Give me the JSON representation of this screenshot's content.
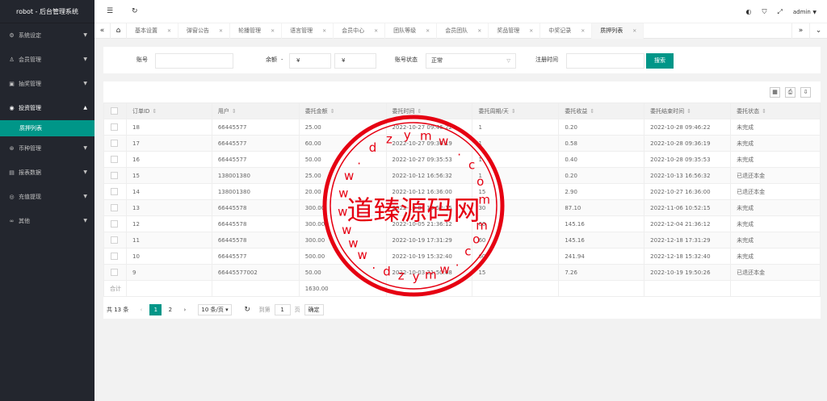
{
  "app_title": "robot - 后台管理系统",
  "sidebar": {
    "items": [
      {
        "icon": "⚙",
        "label": "系统设定"
      },
      {
        "icon": "♙",
        "label": "会员管理"
      },
      {
        "icon": "▣",
        "label": "抽奖管理"
      },
      {
        "icon": "◉",
        "label": "投资管理"
      },
      {
        "icon": "⊛",
        "label": "币种管理"
      },
      {
        "icon": "▤",
        "label": "报表数据"
      },
      {
        "icon": "◎",
        "label": "充值提现"
      },
      {
        "icon": "∞",
        "label": "其他"
      }
    ],
    "sub_item": "质押列表"
  },
  "topbar": {
    "user": "admin"
  },
  "tabs": [
    "基本设置",
    "弹窗公告",
    "轮播管理",
    "语言管理",
    "会员中心",
    "团队等级",
    "会员团队",
    "奖品管理",
    "中奖记录",
    "质押列表"
  ],
  "search": {
    "account_label": "账号",
    "balance_label": "余额",
    "range_dash": "-",
    "currency": "¥",
    "status_label": "账号状态",
    "status_value": "正常",
    "reg_time_label": "注册时间",
    "search_button": "搜索"
  },
  "table": {
    "headers": [
      "订单ID",
      "用户",
      "委托金额",
      "委托时间",
      "委托周期/天",
      "委托收益",
      "委托结束时间",
      "委托状态"
    ],
    "rows": [
      [
        "18",
        "66445577",
        "25.00",
        "2022-10-27 09:46:22",
        "1",
        "0.20",
        "2022-10-28 09:46:22",
        "未完成"
      ],
      [
        "17",
        "66445577",
        "60.00",
        "2022-10-27 09:36:19",
        "1",
        "0.58",
        "2022-10-28 09:36:19",
        "未完成"
      ],
      [
        "16",
        "66445577",
        "50.00",
        "2022-10-27 09:35:53",
        "1",
        "0.40",
        "2022-10-28 09:35:53",
        "未完成"
      ],
      [
        "15",
        "138001380",
        "25.00",
        "2022-10-12 16:56:32",
        "1",
        "0.20",
        "2022-10-13 16:56:32",
        "已退还本金"
      ],
      [
        "14",
        "138001380",
        "20.00",
        "2022-10-12 16:36:00",
        "15",
        "2.90",
        "2022-10-27 16:36:00",
        "已退还本金"
      ],
      [
        "13",
        "66445578",
        "300.00",
        "2022-10-07 10:52:15",
        "30",
        "87.10",
        "2022-11-06 10:52:15",
        "未完成"
      ],
      [
        "12",
        "66445578",
        "300.00",
        "2022-10-05 21:36:12",
        "60",
        "145.16",
        "2022-12-04 21:36:12",
        "未完成"
      ],
      [
        "11",
        "66445578",
        "300.00",
        "2022-10-19 17:31:29",
        "60",
        "145.16",
        "2022-12-18 17:31:29",
        "未完成"
      ],
      [
        "10",
        "66445577",
        "500.00",
        "2022-10-19 15:32:40",
        "60",
        "241.94",
        "2022-12-18 15:32:40",
        "未完成"
      ],
      [
        "9",
        "66445577002",
        "50.00",
        "2022-10-03 21:50:08",
        "15",
        "7.26",
        "2022-10-19 19:50:26",
        "已退还本金"
      ]
    ],
    "total_label": "合计",
    "total_amount": "1630.00"
  },
  "pager": {
    "total": "共 13 条",
    "pages": [
      "1",
      "2"
    ],
    "per_page": "10 条/页",
    "goto_label": "到第",
    "goto_value": "1",
    "page_unit": "页",
    "confirm": "确定"
  },
  "watermark": {
    "main": "道臻源码网",
    "ring_text": "www.dzymw.com"
  },
  "colors": {
    "accent": "#009688",
    "sidebar": "#23262e",
    "watermark": "#e60012"
  }
}
